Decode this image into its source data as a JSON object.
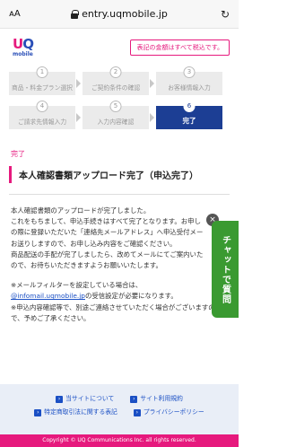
{
  "browser": {
    "text_size": "ᴀA",
    "url": "entry.uqmobile.jp",
    "reload_icon": "reload-icon"
  },
  "header": {
    "logo_uq_u": "U",
    "logo_uq_q": "Q",
    "logo_mobile": "mobile",
    "tax_note": "表記の金額はすべて税込です。"
  },
  "steps": [
    {
      "num": "1",
      "label": "商品・料金プラン選択"
    },
    {
      "num": "2",
      "label": "ご契約条件の確認"
    },
    {
      "num": "3",
      "label": "お客様情報入力"
    },
    {
      "num": "4",
      "label": "ご請求先情報入力"
    },
    {
      "num": "5",
      "label": "入力内容確認"
    },
    {
      "num": "6",
      "label": "完了"
    }
  ],
  "breadcrumb": "完了",
  "page_title": "本人確認書類アップロード完了（申込完了）",
  "body": {
    "p1_l1": "本人確認書類のアップロードが完了しました。",
    "p1_l2": "これをもちまして、申込手続きはすべて完了となります。お申し",
    "p1_l3": "の際に登録いただいた「連絡先メールアドレス」へ申込受付メー",
    "p1_l4": "お送りしますので、お申し込み内容をご確認ください。",
    "p1_l5": "商品配送の手配が完了しましたら、改めてメールにてご案内いた",
    "p1_l6": "ので、お待ちいただきますようお願いいたします。",
    "p2_l1": "※メールフィルターを設定している場合は、",
    "p2_link": "@infomail.uqmobile.jp",
    "p2_l2_rest": "の受信設定が必要になります。",
    "p2_l3": "※申込内容確認等で、別途ご連絡させていただく場合がございますの",
    "p2_l4": "で、予めご了承ください。"
  },
  "chat": {
    "close": "×",
    "label": "チャットで質問"
  },
  "footer": {
    "links": [
      "当サイトについて",
      "サイト利用規約",
      "特定商取引法に関する表記",
      "プライバシーポリシー"
    ],
    "copyright": "Copyright © UQ Communications Inc. all rights reserved."
  }
}
